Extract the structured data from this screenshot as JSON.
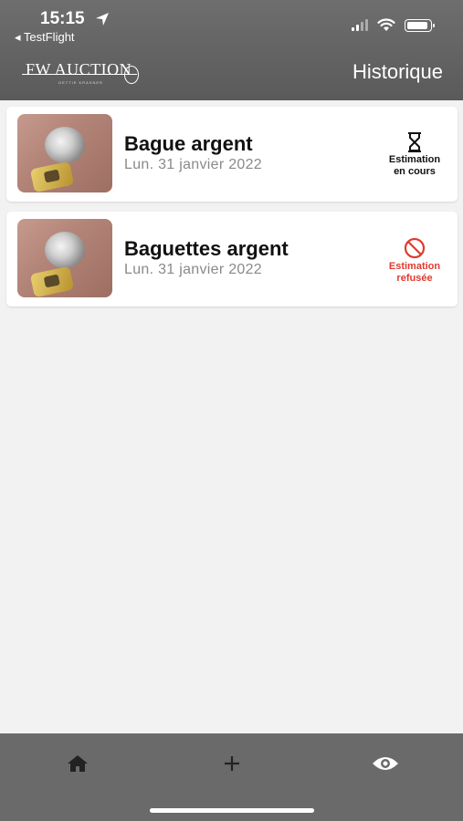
{
  "status_bar": {
    "time": "15:15",
    "back_app": "◂ TestFlight"
  },
  "header": {
    "logo_text": "FW AUCTION",
    "logo_sub": "GETTIE KRASNER",
    "title": "Historique"
  },
  "items": [
    {
      "title": "Bague argent",
      "date": "Lun. 31 janvier 2022",
      "status_icon": "hourglass-icon",
      "status_line1": "Estimation",
      "status_line2": "en cours",
      "status_color": "#111111"
    },
    {
      "title": "Baguettes argent",
      "date": "Lun. 31 janvier 2022",
      "status_icon": "forbidden-icon",
      "status_line1": "Estimation",
      "status_line2": "refusée",
      "status_color": "#e03a2f"
    }
  ],
  "tabbar": {
    "tabs": [
      {
        "icon": "home-icon"
      },
      {
        "icon": "plus-icon"
      },
      {
        "icon": "eye-icon"
      }
    ]
  }
}
